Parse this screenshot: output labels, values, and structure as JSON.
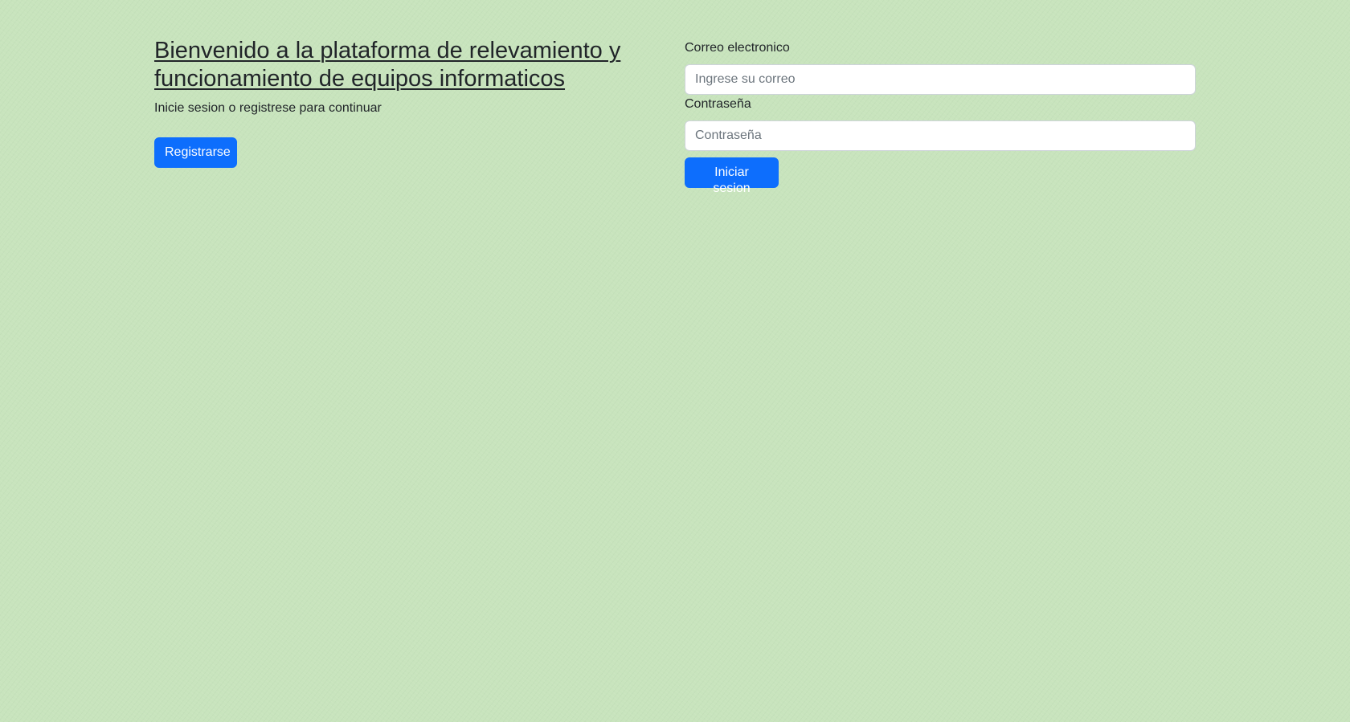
{
  "welcome": {
    "title": "Bienvenido a la plataforma de relevamiento y funcionamiento de equipos informaticos",
    "subtitle": "Inicie sesion o registrese para continuar",
    "register_button": "Registrarse"
  },
  "login_form": {
    "email_label": "Correo electronico",
    "email_placeholder": "Ingrese su correo",
    "email_value": "",
    "password_label": "Contraseña",
    "password_placeholder": "Contraseña",
    "password_value": "",
    "submit_button": "Iniciar sesion"
  },
  "colors": {
    "background": "#c8e4bd",
    "primary_button": "#0d6efd",
    "text": "#212529"
  }
}
